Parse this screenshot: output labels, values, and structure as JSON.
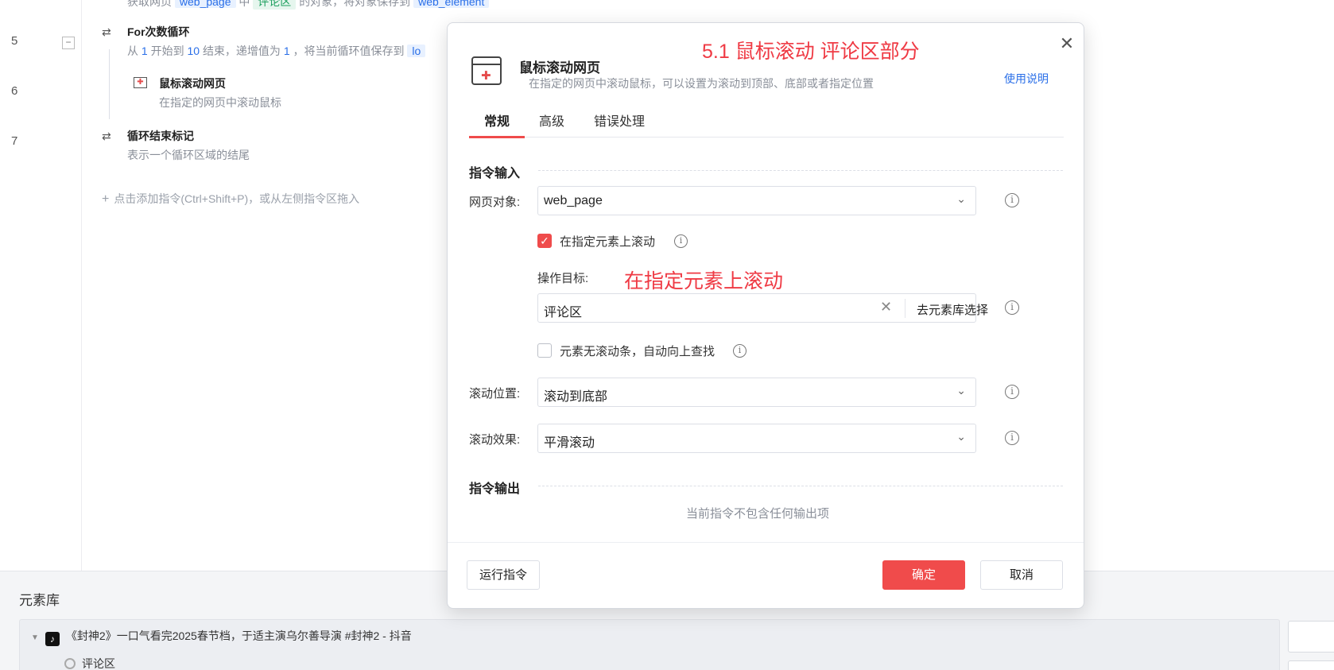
{
  "editor": {
    "line_numbers": [
      "5",
      "6",
      "7"
    ],
    "top_partial": {
      "prefix": "获取网页",
      "page_var": "web_page",
      "mid": "中",
      "elem_name": "评论区",
      "suffix": "的对象，将对象保存到",
      "save_var": "web_element"
    },
    "for_loop": {
      "title": "For次数循环",
      "d1": "从",
      "start": "1",
      "d2": "开始到",
      "end": "10",
      "d3": "结束，递增值为",
      "step": "1",
      "d4": "，将当前循环值保存到",
      "var_partial": "lo"
    },
    "scroll_step": {
      "title": "鼠标滚动网页",
      "desc": "在指定的网页中滚动鼠标"
    },
    "loop_end": {
      "title": "循环结束标记",
      "desc": "表示一个循环区域的结尾"
    },
    "add_hint": "点击添加指令(Ctrl+Shift+P)，或从左侧指令区拖入"
  },
  "element_library": {
    "title": "元素库",
    "page_item": "《封神2》一口气看完2025春节档，于适主演乌尔善导演 #封神2 - 抖音",
    "child_item": "评论区"
  },
  "dialog": {
    "title": "鼠标滚动网页",
    "subtitle": "在指定的网页中滚动鼠标，可以设置为滚动到顶部、底部或者指定位置",
    "help_link": "使用说明",
    "annotation_top": "5.1 鼠标滚动 评论区部分",
    "tabs": [
      "常规",
      "高级",
      "错误处理"
    ],
    "section_input": "指令输入",
    "web_object": {
      "label": "网页对象:",
      "value": "web_page"
    },
    "scroll_on_element": {
      "label": "在指定元素上滚动",
      "checked": true
    },
    "target": {
      "label": "操作目标:",
      "value": "评论区",
      "pick_label": "去元素库选择"
    },
    "annotation_target": "在指定元素上滚动",
    "auto_find": {
      "label": "元素无滚动条，自动向上查找",
      "checked": false
    },
    "scroll_position": {
      "label": "滚动位置:",
      "value": "滚动到底部"
    },
    "scroll_effect": {
      "label": "滚动效果:",
      "value": "平滑滚动"
    },
    "section_output": "指令输出",
    "no_output": "当前指令不包含任何输出项",
    "buttons": {
      "run": "运行指令",
      "ok": "确定",
      "cancel": "取消"
    }
  },
  "colors": {
    "accent": "#ef4b4b",
    "link": "#2a6fe8",
    "annotation": "#ef3a44"
  }
}
